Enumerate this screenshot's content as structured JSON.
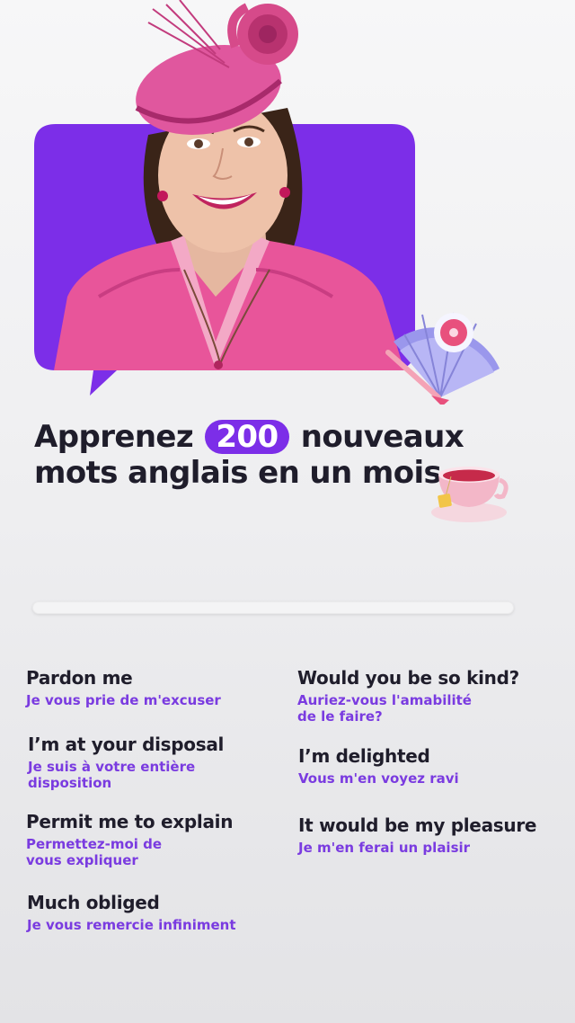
{
  "hero": {
    "illustration": "woman-in-pink-hat-portrait",
    "fan_icon": "fan-icon",
    "accent_color": "#7c2ee8"
  },
  "headline": {
    "part1": "Apprenez",
    "highlight": "200",
    "part2": "nouveaux",
    "line2": "mots anglais en un mois"
  },
  "teacup_icon": "teacup-icon",
  "progress": {
    "value": 0
  },
  "phrases": {
    "left": [
      {
        "en": "Pardon me",
        "fr": [
          "Je vous prie de m'excuser"
        ]
      },
      {
        "en": "I’m at your disposal",
        "fr": [
          "Je suis à votre entière",
          "disposition"
        ]
      },
      {
        "en": "Permit me to explain",
        "fr": [
          "Permettez-moi de",
          "vous expliquer"
        ]
      },
      {
        "en": "Much obliged",
        "fr": [
          "Je vous remercie infiniment"
        ]
      }
    ],
    "right": [
      {
        "en": "Would you be so kind?",
        "fr": [
          "Auriez-vous l'amabilité",
          "de le faire?"
        ]
      },
      {
        "en": "I’m delighted",
        "fr": [
          "Vous m'en voyez ravi"
        ]
      },
      {
        "en": "It would be my pleasure",
        "fr": [
          "Je m'en ferai un plaisir"
        ]
      }
    ]
  }
}
